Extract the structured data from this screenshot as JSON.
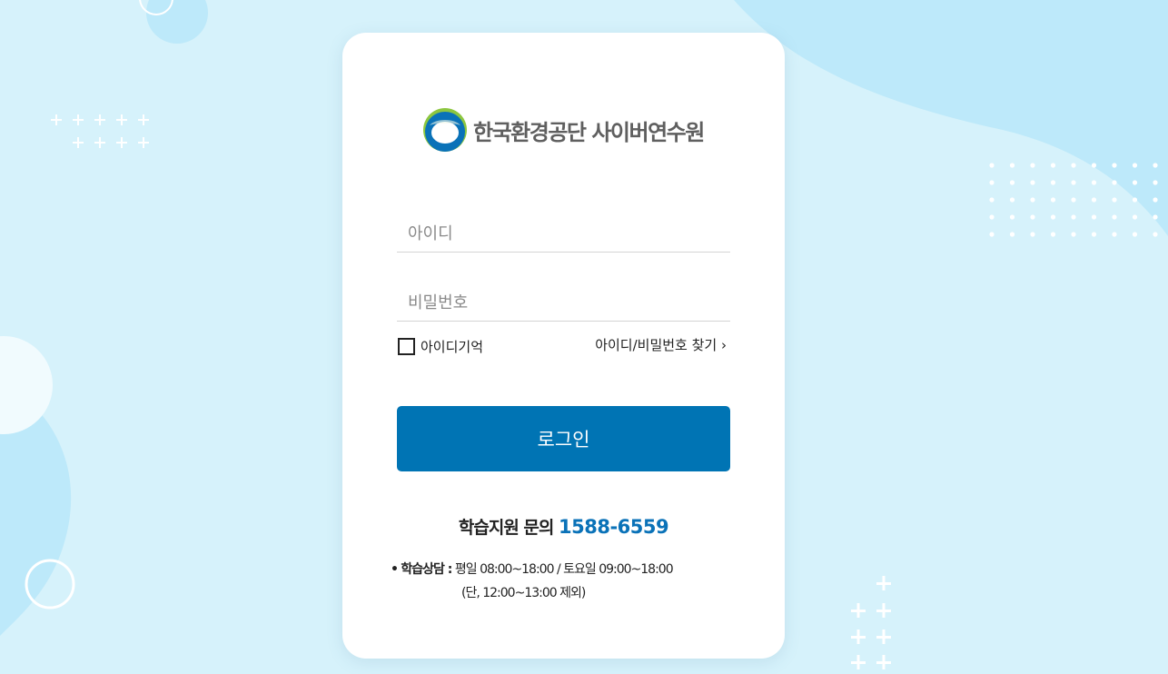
{
  "logo": {
    "org_name": "한국환경공단 사이버연수원"
  },
  "login_form": {
    "id_placeholder": "아이디",
    "pw_placeholder": "비밀번호",
    "remember_label": "아이디기억",
    "find_link": "아이디/비밀번호 찾기 ›",
    "login_button": "로그인"
  },
  "support": {
    "title": "학습지원 문의",
    "phone": "1588-6559",
    "bullet": "•",
    "hours_label": "학습상담 :",
    "hours": "평일 08:00~18:00 / 토요일 09:00~18:00",
    "hours_note": "(단, 12:00~13:00 제외)"
  },
  "colors": {
    "background": "#d6f2fb",
    "primary_button": "#0074b4",
    "phone_accent": "#0a72b8"
  }
}
